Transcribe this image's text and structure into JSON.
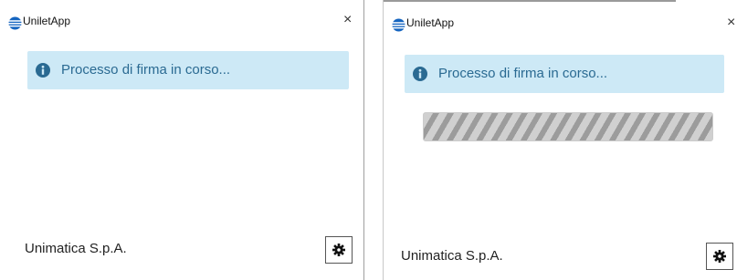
{
  "windows": [
    {
      "title": "UniletApp",
      "close_glyph": "×",
      "alert": {
        "icon": "info-icon",
        "text": "Processo di firma in corso..."
      },
      "footer": {
        "company": "Unimatica S.p.A.",
        "settings_icon": "gear-icon"
      }
    },
    {
      "title": "UniletApp",
      "close_glyph": "×",
      "alert": {
        "icon": "info-icon",
        "text": "Processo di firma in corso..."
      },
      "progress": {
        "state": "indeterminate"
      },
      "footer": {
        "company": "Unimatica S.p.A.",
        "settings_icon": "gear-icon"
      }
    }
  ],
  "colors": {
    "alert_background": "#cde9f6",
    "alert_text": "#2a6a92",
    "logo_blue": "#1565c0"
  }
}
